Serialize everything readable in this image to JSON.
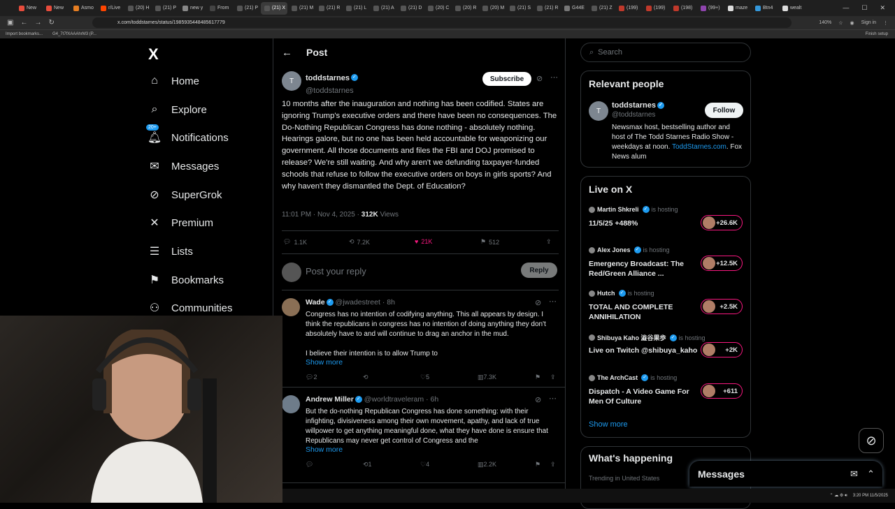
{
  "browser": {
    "tabs": [
      "New",
      "New",
      "Asmo",
      "r/Live",
      "(20) H",
      "(21) P",
      "new y",
      "From",
      "(21) P",
      "(21) X",
      "(21) M",
      "(21) R",
      "(21) L",
      "(21) A",
      "(21) D",
      "(20) C",
      "(20) R",
      "(20) M",
      "(21) S",
      "(21) R",
      "G44E",
      "(21) Z",
      "(199)",
      "(199)",
      "(198)",
      "(99+)",
      "maze",
      "Btn4",
      "wealt"
    ],
    "active_tab_index": 9,
    "url": "x.com/toddstarnes/status/1985935448485617779",
    "zoom": "140%",
    "sign_in": "Sign in",
    "bookmarks": [
      "Import bookmarks...",
      "G4_7t7fXAAAhrM3 (P..."
    ],
    "finish_setup": "Finish setup"
  },
  "leftnav": {
    "logo": "X",
    "items": [
      {
        "label": "Home",
        "icon": "home-icon"
      },
      {
        "label": "Explore",
        "icon": "search-icon"
      },
      {
        "label": "Notifications",
        "icon": "bell-icon",
        "badge": "20+"
      },
      {
        "label": "Messages",
        "icon": "mail-icon"
      },
      {
        "label": "SuperGrok",
        "icon": "grok-icon"
      },
      {
        "label": "Premium",
        "icon": "x-logo-icon"
      },
      {
        "label": "Lists",
        "icon": "list-icon"
      },
      {
        "label": "Bookmarks",
        "icon": "bookmark-icon"
      },
      {
        "label": "Communities",
        "icon": "communities-icon"
      }
    ]
  },
  "header": {
    "title": "Post"
  },
  "post": {
    "name": "toddstarnes",
    "handle": "@toddstarnes",
    "subscribe": "Subscribe",
    "text": "10 months after the inauguration and nothing has been codified. States are ignoring Trump's executive orders and there have been no consequences. The Do-Nothing Republican Congress has done nothing - absolutely nothing. Hearings galore, but no one has been held accountable for weaponizing our government. All those documents and files the FBI and DOJ promised to release? We're still waiting. And why aren't we defunding taxpayer-funded schools that refuse to follow the executive orders on boys in girls sports? And why haven't they dismantled the Dept. of Education?",
    "time": "11:01 PM · Nov 4, 2025 ·",
    "views": "312K",
    "views_label": "Views",
    "replies": "1.1K",
    "reposts": "7.2K",
    "likes": "21K",
    "bookmarks": "512"
  },
  "reply_box": {
    "placeholder": "Post your reply",
    "button": "Reply"
  },
  "replies": [
    {
      "name": "Wade",
      "handle": "@jwadestreet",
      "time": "8h",
      "text": "Congress has no intention of codifying anything. This all appears by design. I think the republicans in congress has no intention of doing anything they don't absolutely  have to and will continue to drag an anchor in the mud.",
      "text2": "I believe their intention is to allow Trump to",
      "show_more": "Show more",
      "replies": "2",
      "reposts": "",
      "likes": "5",
      "views": "7.3K"
    },
    {
      "name": "Andrew Miller",
      "handle": "@worldtraveleram",
      "time": "6h",
      "text": "But the do-nothing Republican Congress has done something: with their infighting, divisiveness among their own movement, apathy, and lack of true willpower to get anything meaningful done, what they have done is ensure that Republicans may never get control of Congress and the",
      "show_more": "Show more",
      "replies": "",
      "reposts": "1",
      "likes": "4",
      "views": "2.2K"
    }
  ],
  "search": {
    "placeholder": "Search"
  },
  "relevant": {
    "title": "Relevant people",
    "name": "toddstarnes",
    "handle": "@toddstarnes",
    "follow": "Follow",
    "bio": "Newsmax host, bestselling author and host of The Todd Starnes Radio Show - weekdays at noon.",
    "bio_link": "ToddStarnes.com",
    "bio_end": ". Fox News alum"
  },
  "live": {
    "title": "Live on X",
    "is_hosting": "is hosting",
    "items": [
      {
        "host": "Martin Shkreli",
        "title": "11/5/25 +488%",
        "count": "+26.6K"
      },
      {
        "host": "Alex Jones",
        "title": "Emergency Broadcast: The Red/Green Alliance ...",
        "count": "+12.5K"
      },
      {
        "host": "Hutch",
        "title": "TOTAL AND COMPLETE ANNIHILATION",
        "count": "+2.5K"
      },
      {
        "host": "Shibuya Kaho 澁谷果歩",
        "title": "Live on Twitch @shibuya_kaho",
        "count": "+2K"
      },
      {
        "host": "The ArchCast",
        "title": "Dispatch - A Video Game For Men Of Culture",
        "count": "+611"
      }
    ],
    "show_more": "Show more"
  },
  "whats_happening": {
    "title": "What's happening",
    "trend": "Trending in United States"
  },
  "messages_dock": {
    "title": "Messages"
  },
  "taskbar": {
    "time": "3:20 PM",
    "date": "11/5/2025"
  },
  "colors": {
    "accent": "#1d9bf0",
    "like": "#f91880",
    "border": "#2f3336",
    "muted": "#71767b"
  }
}
